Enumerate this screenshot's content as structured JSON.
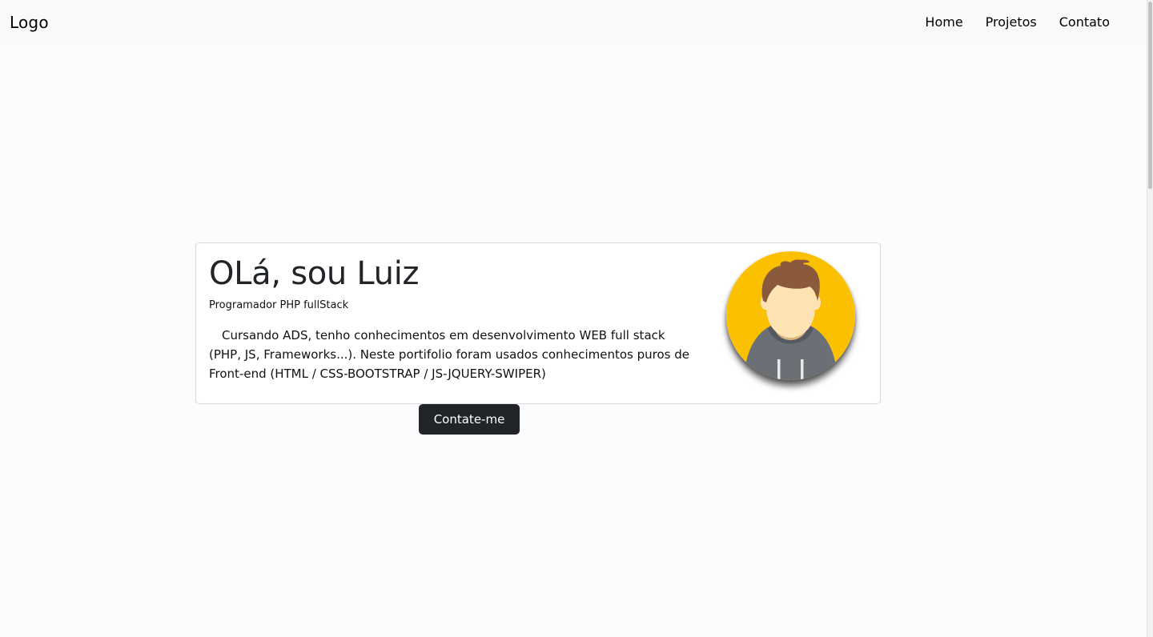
{
  "navbar": {
    "logo": "Logo",
    "links": [
      {
        "label": "Home"
      },
      {
        "label": "Projetos"
      },
      {
        "label": "Contato"
      }
    ]
  },
  "hero": {
    "title": "OLá, sou Luiz",
    "subtitle": "Programador PHP fullStack",
    "description": "Cursando ADS, tenho conhecimentos em desenvolvimento WEB full stack (PHP, JS, Frameworks...). Neste portifolio foram usados conhecimentos puros de Front-end (HTML / CSS-BOOTSTRAP / JS-JQUERY-SWIPER)",
    "avatar_icon": "user-avatar-icon",
    "cta_label": "Contate-me"
  },
  "colors": {
    "navbar_bg": "#f8f9fa",
    "page_bg": "#fcfcff",
    "button_bg": "#212529",
    "avatar_bg": "#fbc000",
    "hoodie": "#6b6f76",
    "hair": "#8b5a3c",
    "skin": "#fde3b4"
  }
}
